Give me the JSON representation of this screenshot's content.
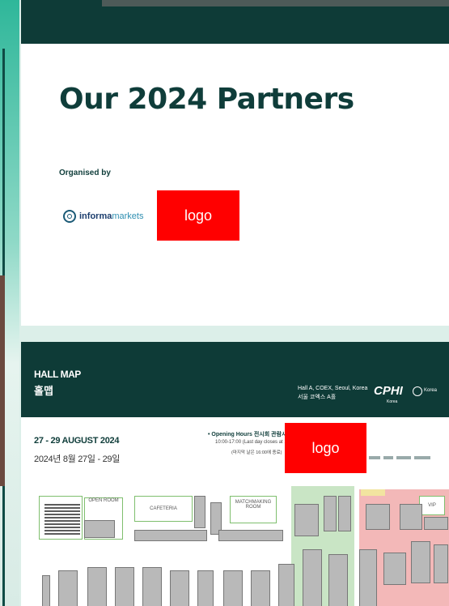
{
  "partners": {
    "title": "Our 2024 Partners",
    "organised_label": "Organised by",
    "organiser": {
      "brand_bold": "informa",
      "brand_light": "markets"
    },
    "partner_logo_text": "logo"
  },
  "hall_map": {
    "title": "HALL MAP",
    "title_ko": "홀맵",
    "venue": "Hall A, COEX, Seoul, Korea",
    "venue_ko": "서울 코엑스 A홀",
    "brand": "CPHI",
    "brand_sub": "Korea",
    "brand_region": "Korea",
    "dates": "27 - 29 AUGUST 2024",
    "dates_ko": "2024년 8월 27일 - 29일",
    "hours_label": "• Opening Hours 전시회 관람시간",
    "hours_time": "10:00-17:00 (Last day closes at 16:00)",
    "hours_note": "(마지막 날은 16:00에 종료)",
    "logo_text": "logo",
    "rooms": {
      "open_room": "OPEN ROOM",
      "cafeteria": "CAFETERIA",
      "matchmaking": "MATCHMAKING ROOM",
      "vip": "VIP"
    }
  },
  "colors": {
    "brand_dark": "#0e3b37",
    "logo_placeholder": "#ff0000",
    "background": "#dcefe9"
  }
}
